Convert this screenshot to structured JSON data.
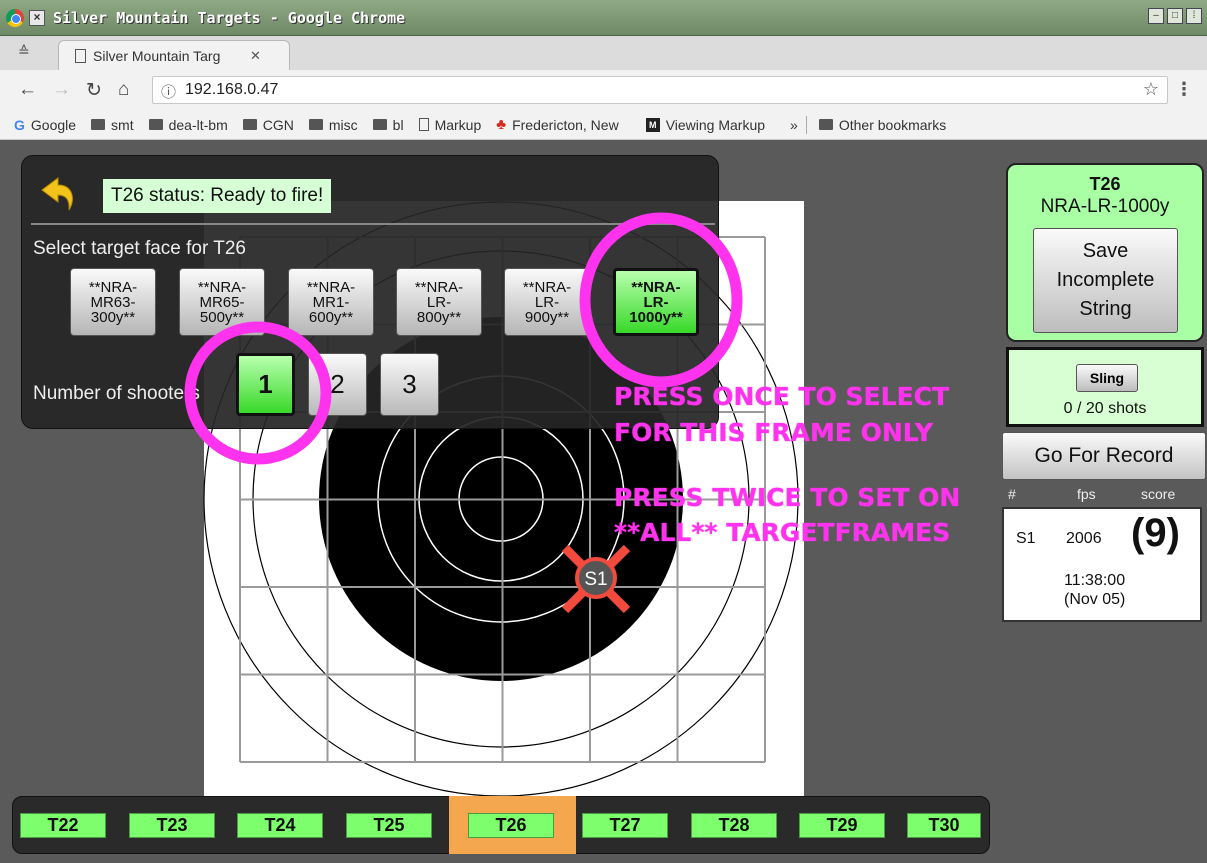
{
  "window": {
    "title": "Silver Mountain Targets - Google Chrome",
    "tab_label": "Silver Mountain Targ",
    "url": "192.168.0.47"
  },
  "bookmarks": [
    {
      "label": "Google",
      "icon": "google-icon"
    },
    {
      "label": "smt",
      "icon": "folder-icon"
    },
    {
      "label": "dea-lt-bm",
      "icon": "folder-icon"
    },
    {
      "label": "CGN",
      "icon": "folder-icon"
    },
    {
      "label": "misc",
      "icon": "folder-icon"
    },
    {
      "label": "bl",
      "icon": "folder-icon"
    },
    {
      "label": "Markup",
      "icon": "page-icon"
    },
    {
      "label": "Fredericton, New",
      "icon": "maple-leaf-icon"
    },
    {
      "label": "Viewing Markup",
      "icon": "markup-icon"
    },
    {
      "label": "»",
      "icon": ""
    },
    {
      "label": "Other bookmarks",
      "icon": "folder-icon"
    }
  ],
  "panel": {
    "status": "T26 status: Ready to fire!",
    "face_label": "Select target face for T26",
    "faces": [
      {
        "line1": "**NRA-",
        "line2": "MR63-",
        "line3": "300y**",
        "selected": false
      },
      {
        "line1": "**NRA-",
        "line2": "MR65-",
        "line3": "500y**",
        "selected": false
      },
      {
        "line1": "**NRA-",
        "line2": "MR1-",
        "line3": "600y**",
        "selected": false
      },
      {
        "line1": "**NRA-",
        "line2": "LR-",
        "line3": "800y**",
        "selected": false
      },
      {
        "line1": "**NRA-",
        "line2": "LR-",
        "line3": "900y**",
        "selected": false
      },
      {
        "line1": "**NRA-",
        "line2": "LR-",
        "line3": "1000y**",
        "selected": true
      }
    ],
    "shooters_label": "Number of shooters",
    "shooters": [
      "1",
      "2",
      "3"
    ],
    "shooters_selected": "1"
  },
  "annotations": {
    "line1": "PRESS ONCE TO SELECT",
    "line2": "FOR THIS FRAME ONLY",
    "line3": "PRESS TWICE TO SET ON",
    "line4": "**ALL** TARGETFRAMES",
    "color": "#ff33ee"
  },
  "shot_marker": "S1",
  "target_info": {
    "name": "T26",
    "face": "NRA-LR-1000y",
    "save_line1": "Save",
    "save_line2": "Incomplete",
    "save_line3": "String"
  },
  "sling": {
    "label": "Sling",
    "count": "0 / 20 shots"
  },
  "record_button": "Go For Record",
  "shot_table": {
    "headers": [
      "#",
      "fps",
      "score"
    ],
    "rows": [
      {
        "id": "S1",
        "fps": "2006",
        "score": "(9)",
        "time": "11:38:00",
        "date": "(Nov 05)"
      }
    ]
  },
  "frames": [
    "T22",
    "T23",
    "T24",
    "T25",
    "T26",
    "T27",
    "T28",
    "T29",
    "T30"
  ],
  "active_frame": "T26",
  "colors": {
    "selected_green": "#39d829",
    "status_green": "#d6ffd6",
    "active_tab": "#f5a750"
  }
}
